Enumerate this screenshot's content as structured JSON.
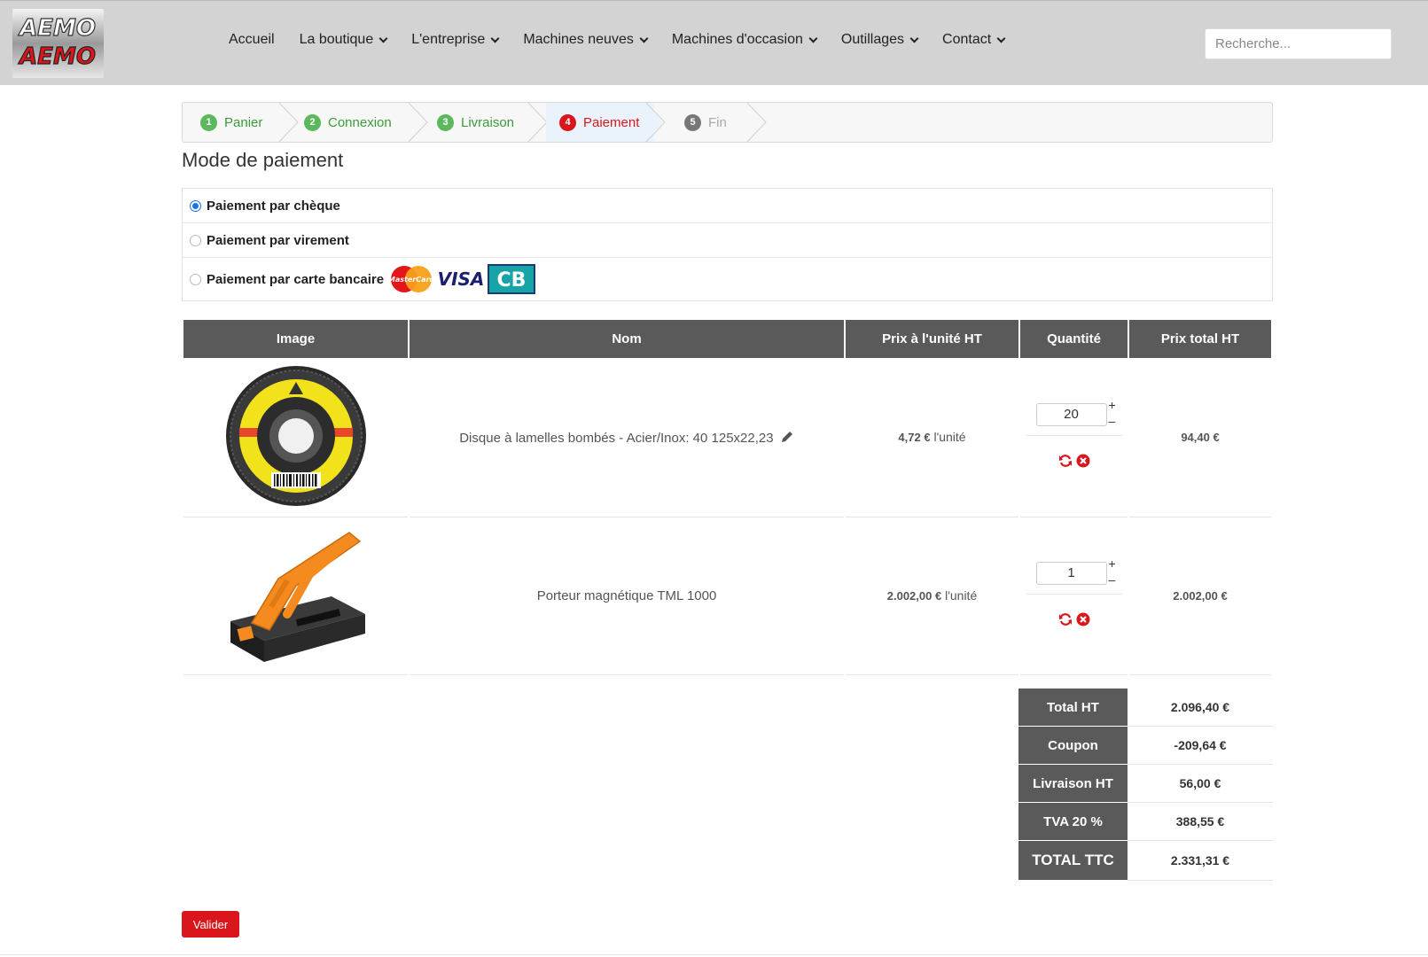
{
  "header": {
    "logo_alt": "AEMO",
    "nav": [
      {
        "label": "Accueil",
        "dropdown": false
      },
      {
        "label": "La boutique",
        "dropdown": true
      },
      {
        "label": "L'entreprise",
        "dropdown": true
      },
      {
        "label": "Machines neuves",
        "dropdown": true
      },
      {
        "label": "Machines d'occasion",
        "dropdown": true
      },
      {
        "label": "Outillages",
        "dropdown": true
      },
      {
        "label": "Contact",
        "dropdown": true
      }
    ],
    "search_placeholder": "Recherche..."
  },
  "steps": [
    {
      "num": "1",
      "label": "Panier",
      "state": "done"
    },
    {
      "num": "2",
      "label": "Connexion",
      "state": "done"
    },
    {
      "num": "3",
      "label": "Livraison",
      "state": "done"
    },
    {
      "num": "4",
      "label": "Paiement",
      "state": "active"
    },
    {
      "num": "5",
      "label": "Fin",
      "state": "pending"
    }
  ],
  "payment": {
    "title": "Mode de paiement",
    "options": [
      {
        "label": "Paiement par chèque",
        "selected": true
      },
      {
        "label": "Paiement par virement",
        "selected": false
      },
      {
        "label": "Paiement par carte bancaire",
        "selected": false
      }
    ],
    "card_logos": {
      "mastercard": "MasterCard",
      "visa": "VISA",
      "cb": "CB"
    }
  },
  "table": {
    "headers": [
      "Image",
      "Nom",
      "Prix à l'unité HT",
      "Quantité",
      "Prix total HT"
    ],
    "rows": [
      {
        "name": "Disque à lamelles bombés - Acier/Inox: 40 125x22,23",
        "unit_price": "4,72 €",
        "unit_suffix": " l'unité",
        "qty": "20",
        "total": "94,40 €"
      },
      {
        "name": "Porteur magnétique TML 1000",
        "unit_price": "2.002,00 €",
        "unit_suffix": " l'unité",
        "qty": "1",
        "total": "2.002,00 €"
      }
    ]
  },
  "totals": [
    {
      "label": "Total HT",
      "value": "2.096,40 €"
    },
    {
      "label": "Coupon",
      "value": "-209,64 €"
    },
    {
      "label": "Livraison HT",
      "value": "56,00 €"
    },
    {
      "label": "TVA 20 %",
      "value": "388,55 €"
    },
    {
      "label": "TOTAL TTC",
      "value": "2.331,31 €"
    }
  ],
  "valider_label": "Valider",
  "colors": {
    "accent_red": "#d9161c",
    "done_green": "#5cb85c",
    "header_gray": "#5a5a5a",
    "radio_blue": "#1a73e8"
  }
}
